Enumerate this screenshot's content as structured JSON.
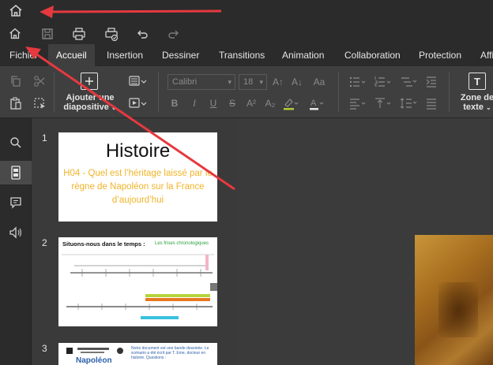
{
  "tabs": {
    "fichier": "Fichier",
    "accueil": "Accueil",
    "insertion": "Insertion",
    "dessiner": "Dessiner",
    "transitions": "Transitions",
    "animation": "Animation",
    "collaboration": "Collaboration",
    "protection": "Protection",
    "affichage": "Affichage"
  },
  "ribbon": {
    "add_slide_label": "Ajouter une diapositive",
    "font_family": "Calibri",
    "font_size": "18",
    "text_box_label": "Zone de texte",
    "bold": "B",
    "italic": "I",
    "underline": "U",
    "strike": "S",
    "superscript": "A²",
    "subscript": "A₂",
    "grow_font": "A↑",
    "shrink_font": "A↓",
    "change_case": "Aa"
  },
  "slides": [
    {
      "number": "1",
      "title": "Histoire",
      "subtitle": "H04 - Quel est l’héritage laissé par le règne de Napoléon sur la France d’aujourd’hui"
    },
    {
      "number": "2",
      "title": "Situons-nous dans le temps :",
      "subtitle": "Les frises chronologiques"
    },
    {
      "number": "3",
      "title": "Napoléon",
      "text": "Notre document est une bande dessinée. Le scénario a été écrit par T. Eme, docteur en histoire. Questions :"
    }
  ],
  "colors": {
    "accent_arrow": "#e5393f",
    "slide1_subtitle": "#f0b429",
    "slide3_blue": "#2d5fa8",
    "timeline_green": "#2aa23c"
  }
}
